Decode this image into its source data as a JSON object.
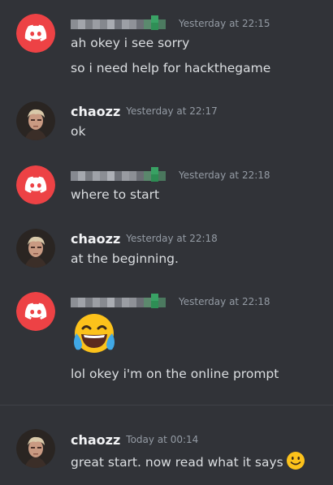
{
  "messages": [
    {
      "author": "",
      "timestamp": "Yesterday at 22:15",
      "lines": [
        "ah okey i see sorry",
        "so i need help for hackthegame"
      ]
    },
    {
      "author": "chaozz",
      "timestamp": "Yesterday at 22:17",
      "lines": [
        "ok"
      ]
    },
    {
      "author": "",
      "timestamp": "Yesterday at 22:18",
      "lines": [
        "where to start"
      ]
    },
    {
      "author": "chaozz",
      "timestamp": "Yesterday at 22:18",
      "lines": [
        "at the beginning."
      ]
    },
    {
      "author": "",
      "timestamp": "Yesterday at 22:18",
      "emoji": "laughing-tears-emoji",
      "lines": [
        "lol okey i'm on the online prompt"
      ]
    },
    {
      "author": "chaozz",
      "timestamp": "Today at 00:14",
      "lines": [
        "great start. now read what it says"
      ],
      "trailing_emoji": "slight-smile-emoji"
    }
  ],
  "colors": {
    "background": "#313338",
    "discord_red": "#ed4245",
    "username": "#f2f3f5",
    "timestamp": "#949ba4",
    "text": "#dbdee1",
    "divider": "#3f4147"
  },
  "icons": {
    "discord_avatar": "discord-logo-icon",
    "user_avatar": "user-photo-avatar"
  }
}
